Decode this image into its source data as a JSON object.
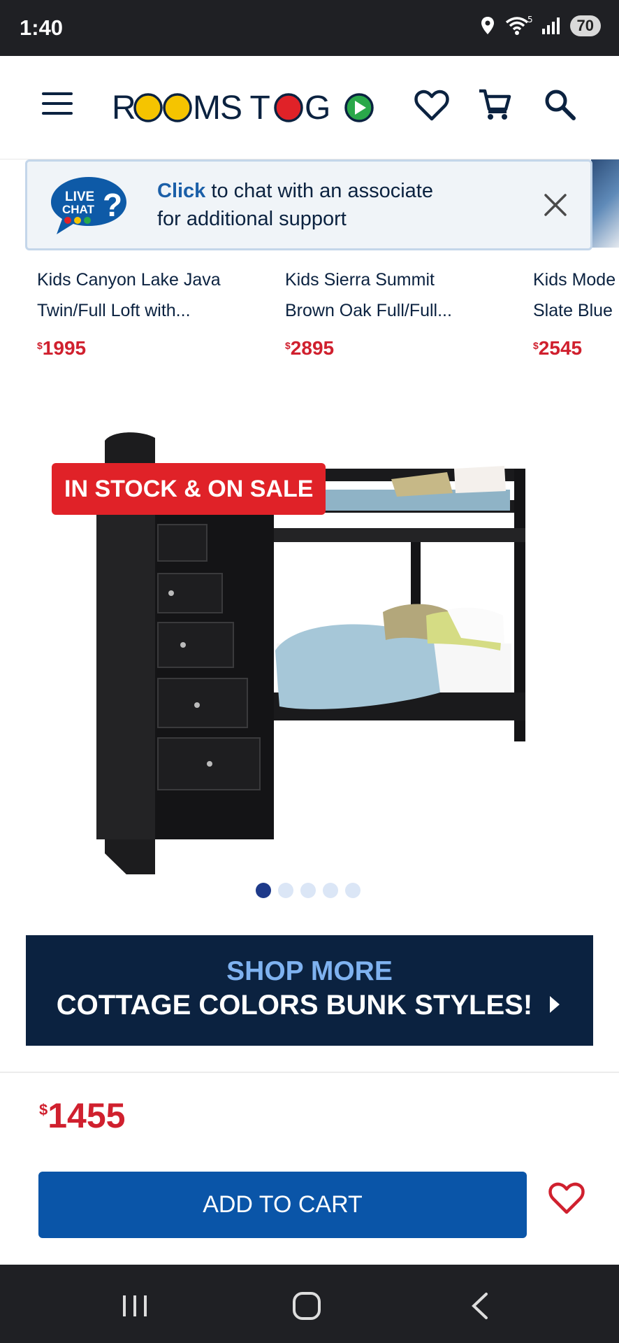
{
  "status": {
    "time": "1:40",
    "battery": "70",
    "icons": [
      "location-icon",
      "wifi-icon",
      "signal-icon",
      "battery-icon"
    ]
  },
  "header": {
    "brand": "ROOMS TO GO",
    "icons": [
      "menu-icon",
      "heart-icon",
      "cart-icon",
      "search-icon"
    ]
  },
  "live_chat": {
    "badge_line1": "LIVE",
    "badge_line2": "CHAT",
    "bold": "Click",
    "line1_rest": "to chat with an associate",
    "line2": "for additional support"
  },
  "recommendations": [
    {
      "name_line1": "Kids Canyon Lake Java",
      "name_line2": "Twin/Full Loft with...",
      "currency": "$",
      "price": "1995"
    },
    {
      "name_line1": "Kids Sierra Summit",
      "name_line2": "Brown Oak Full/Full...",
      "currency": "$",
      "price": "2895"
    },
    {
      "name_line1": "Kids Mode",
      "name_line2": "Slate Blue",
      "currency": "$",
      "price": "2545"
    }
  ],
  "product": {
    "badge": "IN STOCK & ON SALE",
    "image_count": 5,
    "active_image": 1
  },
  "shop_more": {
    "line1": "SHOP MORE",
    "line2": "COTTAGE COLORS BUNK STYLES!"
  },
  "price": {
    "currency": "$",
    "value": "1455"
  },
  "actions": {
    "add_to_cart": "ADD TO CART"
  },
  "colors": {
    "navy": "#0b2240",
    "sale_red": "#d0202e",
    "cart_blue": "#0a55a8",
    "accent_light_blue": "#7fb2f0"
  }
}
